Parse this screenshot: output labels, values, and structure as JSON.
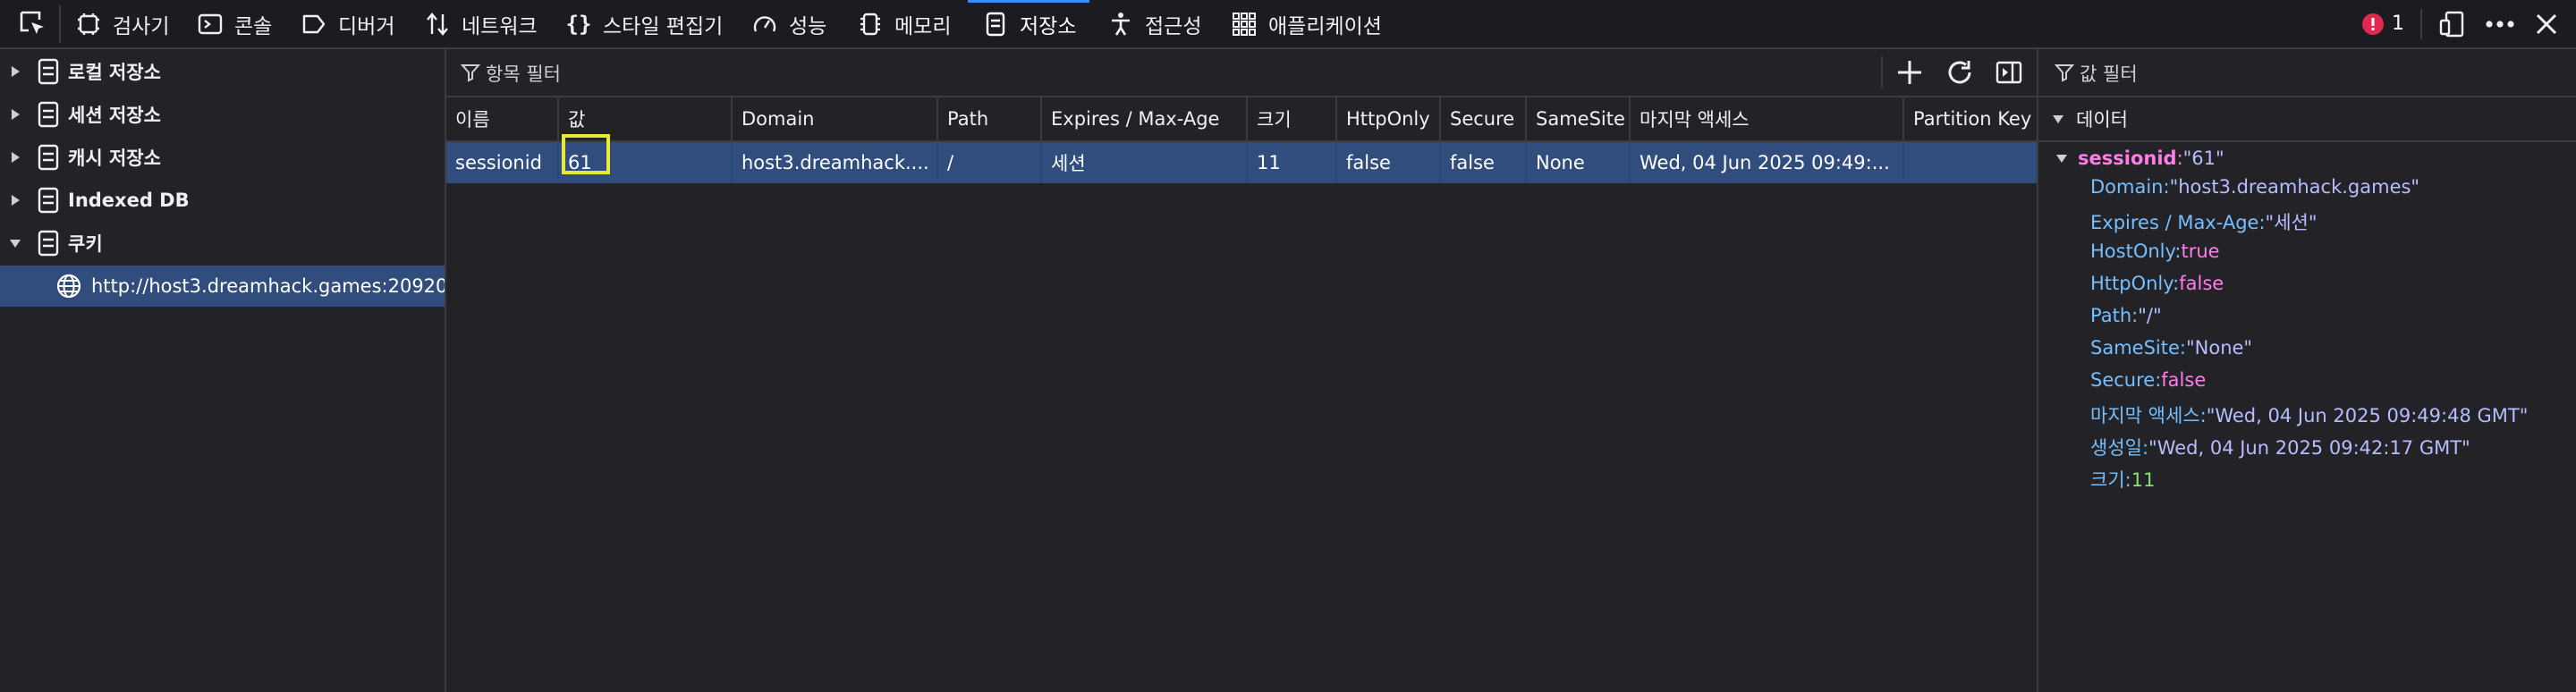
{
  "toolbar": {
    "tabs": [
      {
        "label": "검사기",
        "icon": "inspector-icon"
      },
      {
        "label": "콘솔",
        "icon": "console-icon"
      },
      {
        "label": "디버거",
        "icon": "debugger-icon"
      },
      {
        "label": "네트워크",
        "icon": "network-icon"
      },
      {
        "label": "스타일 편집기",
        "icon": "style-editor-icon"
      },
      {
        "label": "성능",
        "icon": "performance-icon"
      },
      {
        "label": "메모리",
        "icon": "memory-icon"
      },
      {
        "label": "저장소",
        "icon": "storage-icon",
        "selected": true
      },
      {
        "label": "접근성",
        "icon": "accessibility-icon"
      },
      {
        "label": "애플리케이션",
        "icon": "application-icon"
      }
    ],
    "error_count": "1"
  },
  "sidebar": {
    "items": [
      {
        "label": "로컬 저장소",
        "expanded": false
      },
      {
        "label": "세션 저장소",
        "expanded": false
      },
      {
        "label": "캐시 저장소",
        "expanded": false
      },
      {
        "label": "Indexed DB",
        "expanded": false
      },
      {
        "label": "쿠키",
        "expanded": true
      }
    ],
    "cookie_host": "http://host3.dreamhack.games:20920"
  },
  "table": {
    "filter_placeholder": "항목 필터",
    "columns": [
      "이름",
      "값",
      "Domain",
      "Path",
      "Expires / Max-Age",
      "크기",
      "HttpOnly",
      "Secure",
      "SameSite",
      "마지막 액세스",
      "Partition Key"
    ],
    "rows": [
      [
        "sessionid",
        "61",
        "host3.dreamhack....",
        "/",
        "세션",
        "11",
        "false",
        "false",
        "None",
        "Wed, 04 Jun 2025 09:49:...",
        ""
      ]
    ]
  },
  "details": {
    "filter_placeholder": "값 필터",
    "section_title": "데이터",
    "root_key": "sessionid",
    "root_value": "\"61\"",
    "props": [
      {
        "key": "Domain",
        "value": "\"host3.dreamhack.games\"",
        "type": "string"
      },
      {
        "key": "Expires / Max-Age",
        "value": "\"세션\"",
        "type": "string"
      },
      {
        "key": "HostOnly",
        "value": "true",
        "type": "bool"
      },
      {
        "key": "HttpOnly",
        "value": "false",
        "type": "bool"
      },
      {
        "key": "Path",
        "value": "\"/\"",
        "type": "string"
      },
      {
        "key": "SameSite",
        "value": "\"None\"",
        "type": "string"
      },
      {
        "key": "Secure",
        "value": "false",
        "type": "bool"
      },
      {
        "key": "마지막 액세스",
        "value": "\"Wed, 04 Jun 2025 09:49:48 GMT\"",
        "type": "string"
      },
      {
        "key": "생성일",
        "value": "\"Wed, 04 Jun 2025 09:42:17 GMT\"",
        "type": "string"
      },
      {
        "key": "크기",
        "value": "11",
        "type": "number"
      }
    ]
  },
  "colors": {
    "background": "#232327",
    "selected_row": "#304d7e",
    "highlight_box": "#e6ea36",
    "error_badge": "#e22850",
    "tab_underline": "#3b8eff"
  }
}
